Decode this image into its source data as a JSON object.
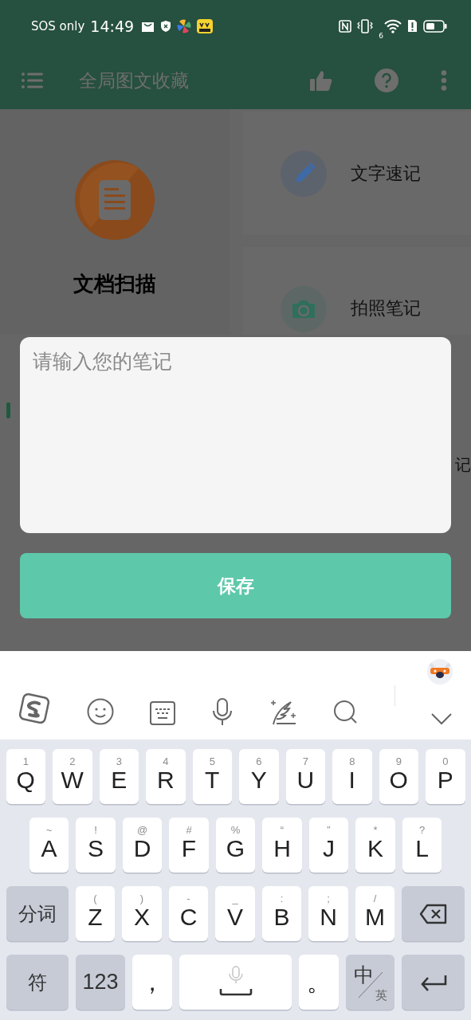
{
  "status_bar": {
    "carrier": "SOS only",
    "time": "14:49",
    "wifi_badge": "6"
  },
  "app_bar": {
    "title": "全局图文收藏"
  },
  "features": {
    "main": {
      "label": "文档扫描"
    },
    "side": [
      {
        "label": "文字速记",
        "kind": "pencil"
      },
      {
        "label": "拍照笔记",
        "kind": "camera"
      }
    ]
  },
  "history": {
    "tab_fragment": "记"
  },
  "dialog": {
    "placeholder": "请输入您的笔记",
    "save_button": "保存"
  },
  "keyboard": {
    "rows": [
      {
        "keys": [
          {
            "kind": "char",
            "label": "Q",
            "hint": "1"
          },
          {
            "kind": "char",
            "label": "W",
            "hint": "2"
          },
          {
            "kind": "char",
            "label": "E",
            "hint": "3"
          },
          {
            "kind": "char",
            "label": "R",
            "hint": "4"
          },
          {
            "kind": "char",
            "label": "T",
            "hint": "5"
          },
          {
            "kind": "char",
            "label": "Y",
            "hint": "6"
          },
          {
            "kind": "char",
            "label": "U",
            "hint": "7"
          },
          {
            "kind": "char",
            "label": "I",
            "hint": "8"
          },
          {
            "kind": "char",
            "label": "O",
            "hint": "9"
          },
          {
            "kind": "char",
            "label": "P",
            "hint": "0"
          }
        ]
      },
      {
        "keys": [
          {
            "kind": "char",
            "label": "A",
            "hint": "~"
          },
          {
            "kind": "char",
            "label": "S",
            "hint": "!"
          },
          {
            "kind": "char",
            "label": "D",
            "hint": "@"
          },
          {
            "kind": "char",
            "label": "F",
            "hint": "#"
          },
          {
            "kind": "char",
            "label": "G",
            "hint": "%"
          },
          {
            "kind": "char",
            "label": "H",
            "hint": "“"
          },
          {
            "kind": "char",
            "label": "J",
            "hint": "”"
          },
          {
            "kind": "char",
            "label": "K",
            "hint": "*"
          },
          {
            "kind": "char",
            "label": "L",
            "hint": "?"
          }
        ]
      },
      {
        "keys": [
          {
            "kind": "func",
            "label": "分词"
          },
          {
            "kind": "char",
            "label": "Z",
            "hint": "("
          },
          {
            "kind": "char",
            "label": "X",
            "hint": ")"
          },
          {
            "kind": "char",
            "label": "C",
            "hint": "-"
          },
          {
            "kind": "char",
            "label": "V",
            "hint": "_"
          },
          {
            "kind": "char",
            "label": "B",
            "hint": ":"
          },
          {
            "kind": "char",
            "label": "N",
            "hint": ";"
          },
          {
            "kind": "char",
            "label": "M",
            "hint": "/"
          },
          {
            "kind": "delete"
          }
        ]
      },
      {
        "keys": [
          {
            "kind": "func",
            "label": "符"
          },
          {
            "kind": "func",
            "label": "123"
          },
          {
            "kind": "char",
            "label": "，"
          },
          {
            "kind": "space"
          },
          {
            "kind": "char",
            "label": "。"
          },
          {
            "kind": "lang",
            "label": "中",
            "sub": "英"
          },
          {
            "kind": "enter"
          }
        ]
      }
    ]
  }
}
